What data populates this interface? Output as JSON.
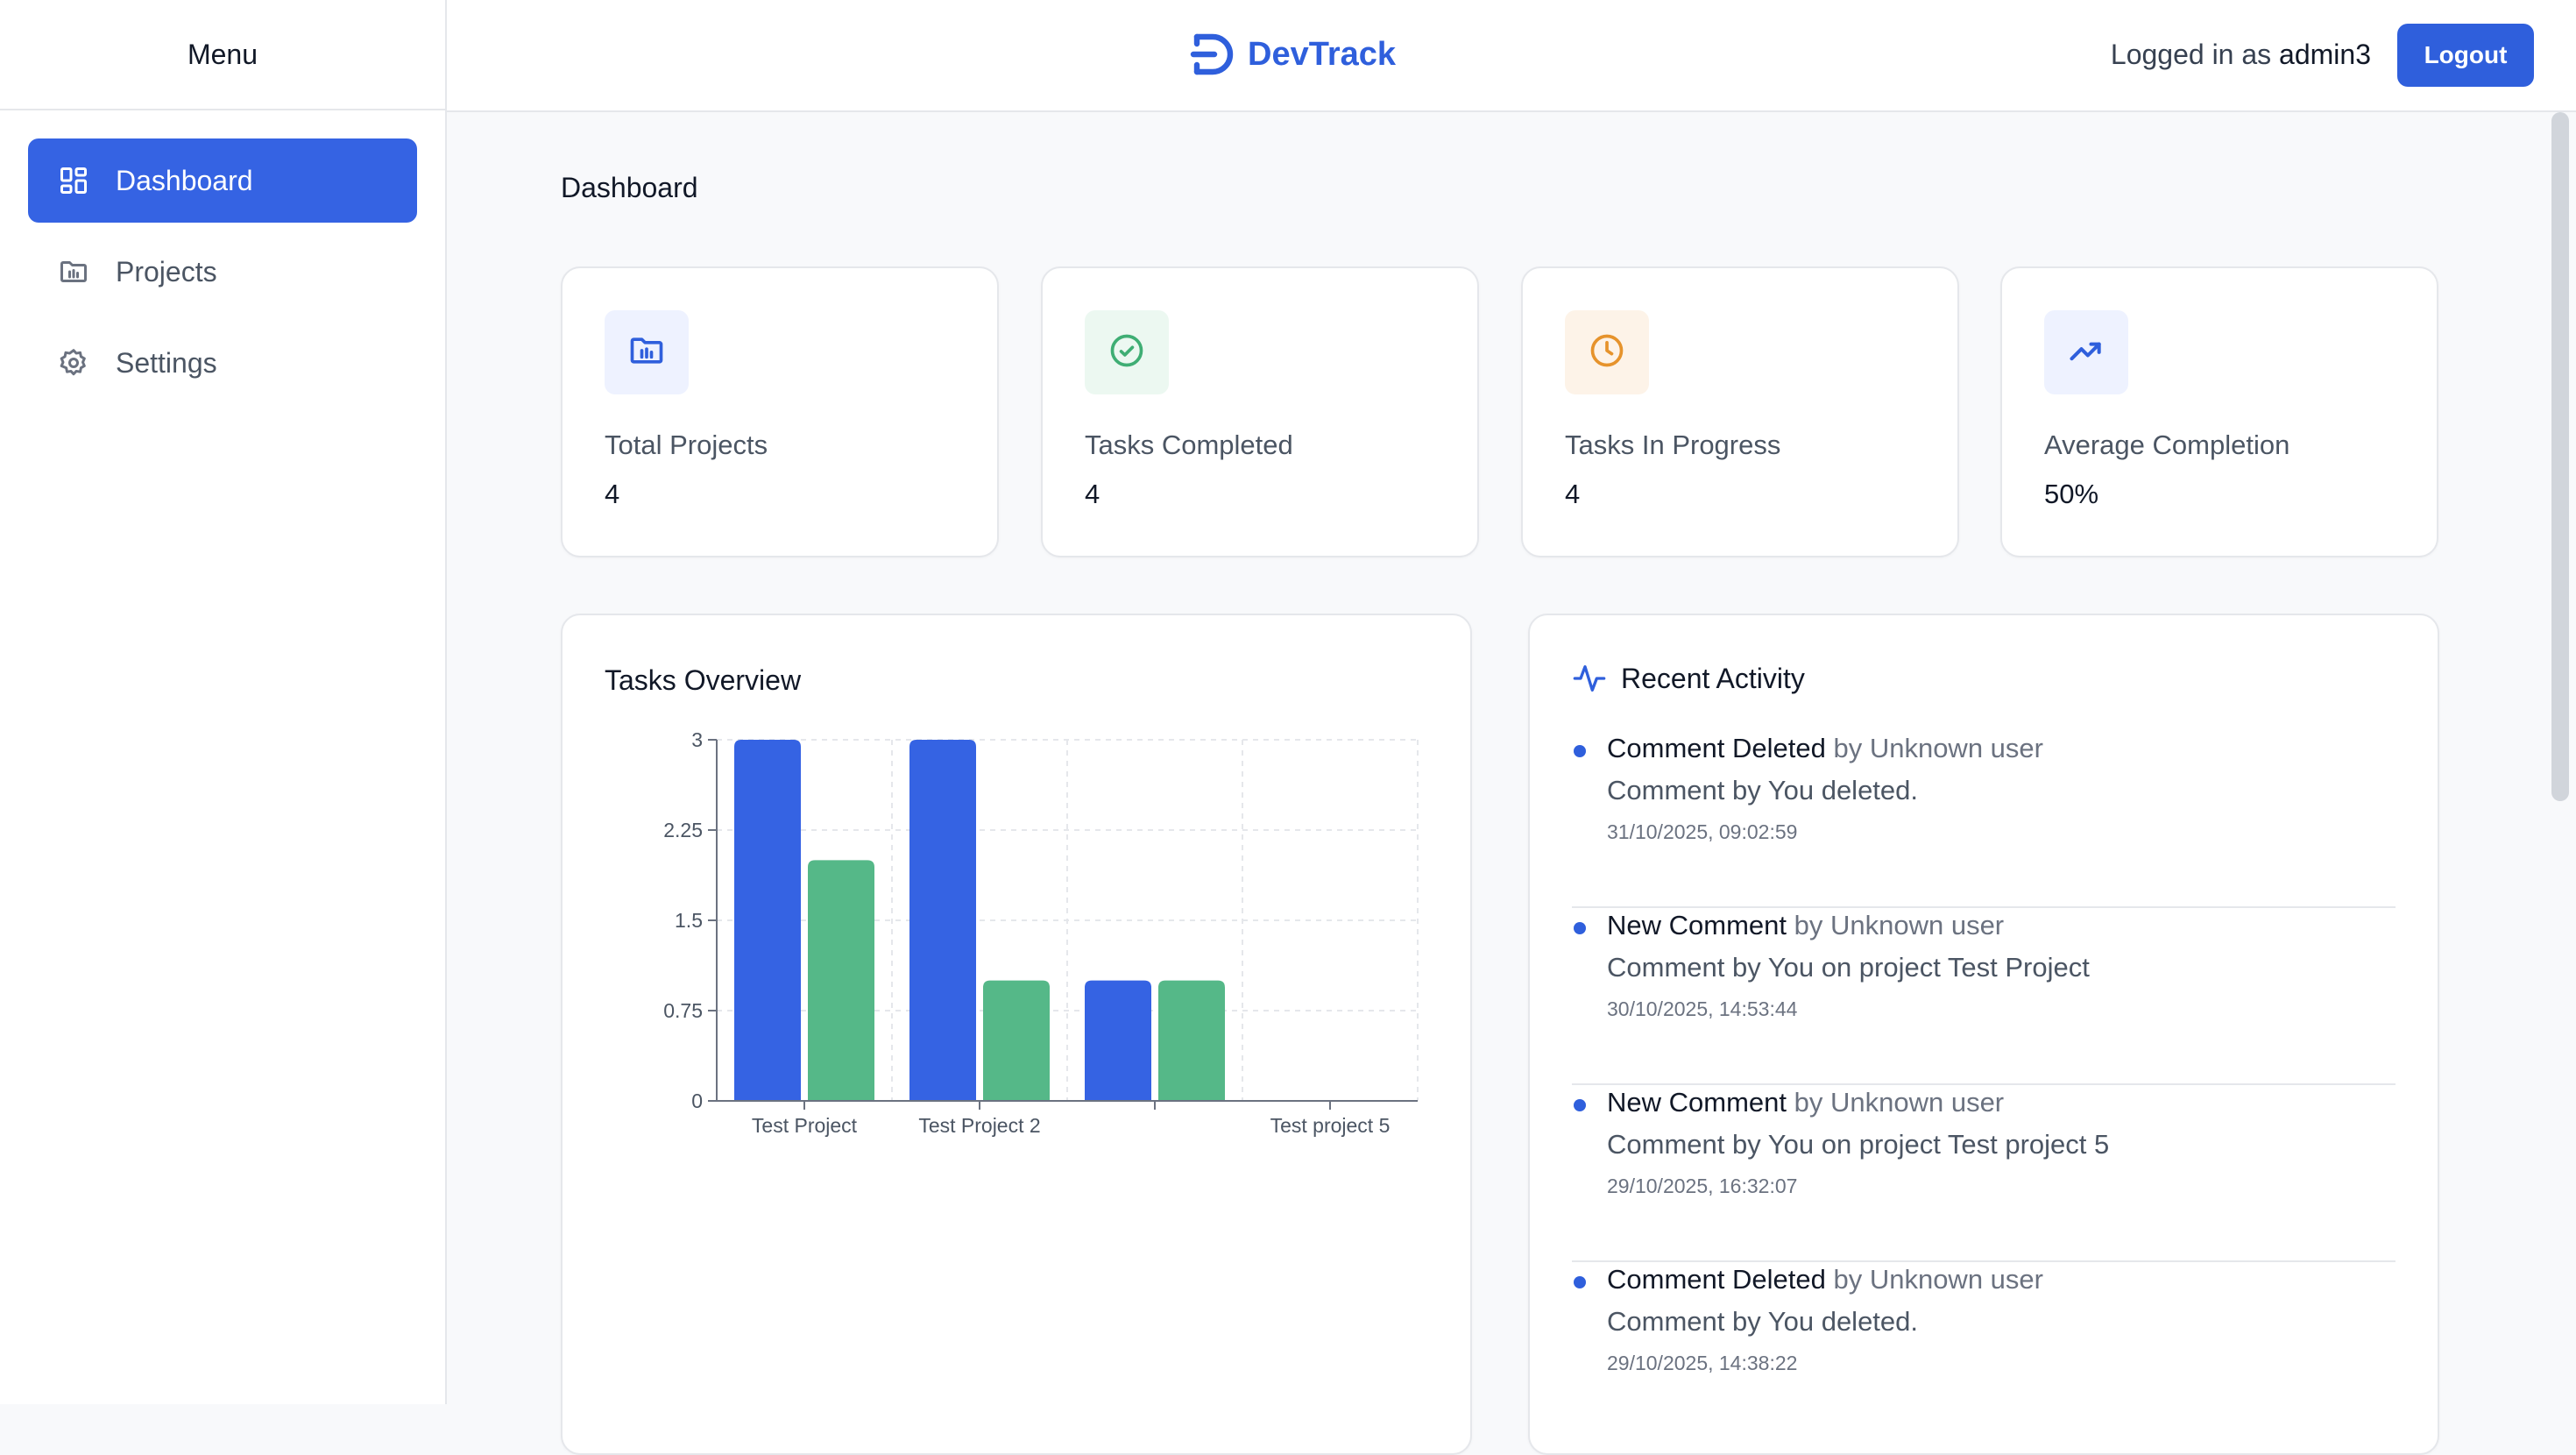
{
  "sidebar": {
    "title": "Menu",
    "items": [
      {
        "label": "Dashboard",
        "icon": "dashboard-icon",
        "active": true
      },
      {
        "label": "Projects",
        "icon": "folder-icon",
        "active": false
      },
      {
        "label": "Settings",
        "icon": "gear-icon",
        "active": false
      }
    ]
  },
  "header": {
    "brand": "DevTrack",
    "user_prefix": "Logged in as",
    "username": "admin3",
    "logout_label": "Logout"
  },
  "main": {
    "title": "Dashboard",
    "stats": [
      {
        "label": "Total Projects",
        "value": "4",
        "icon": "folder-chart-icon",
        "color": "#2f5fdc",
        "bg": "#eef2ff"
      },
      {
        "label": "Tasks Completed",
        "value": "4",
        "icon": "check-circle-icon",
        "color": "#3fae74",
        "bg": "#ecf8f1"
      },
      {
        "label": "Tasks In Progress",
        "value": "4",
        "icon": "clock-icon",
        "color": "#e6932c",
        "bg": "#fdf3e8"
      },
      {
        "label": "Average Completion",
        "value": "50%",
        "icon": "trending-up-icon",
        "color": "#2f5fdc",
        "bg": "#eef2ff"
      }
    ]
  },
  "chart_data": {
    "type": "bar",
    "title": "Tasks Overview",
    "categories": [
      "Test Project",
      "Test Project 2",
      "",
      "Test project 5"
    ],
    "series": [
      {
        "values": [
          3,
          3,
          1,
          0
        ],
        "color": "#3563e3"
      },
      {
        "values": [
          2,
          1,
          1,
          0
        ],
        "color": "#55b888"
      }
    ],
    "yticks": [
      "0",
      "0.75",
      "1.5",
      "2.25",
      "3"
    ],
    "ylim": [
      0,
      3
    ],
    "grid": true
  },
  "activity": {
    "title": "Recent Activity",
    "items": [
      {
        "type": "Comment Deleted",
        "by": "by Unknown user",
        "detail": "Comment by You deleted.",
        "time": "31/10/2025, 09:02:59"
      },
      {
        "type": "New Comment",
        "by": "by Unknown user",
        "detail": "Comment by You on project Test Project",
        "time": "30/10/2025, 14:53:44"
      },
      {
        "type": "New Comment",
        "by": "by Unknown user",
        "detail": "Comment by You on project Test project 5",
        "time": "29/10/2025, 16:32:07"
      },
      {
        "type": "Comment Deleted",
        "by": "by Unknown user",
        "detail": "Comment by You deleted.",
        "time": "29/10/2025, 14:38:22"
      }
    ]
  },
  "colors": {
    "accent": "#2f5fdc",
    "border": "#e5e7eb",
    "background": "#f8f9fb"
  }
}
